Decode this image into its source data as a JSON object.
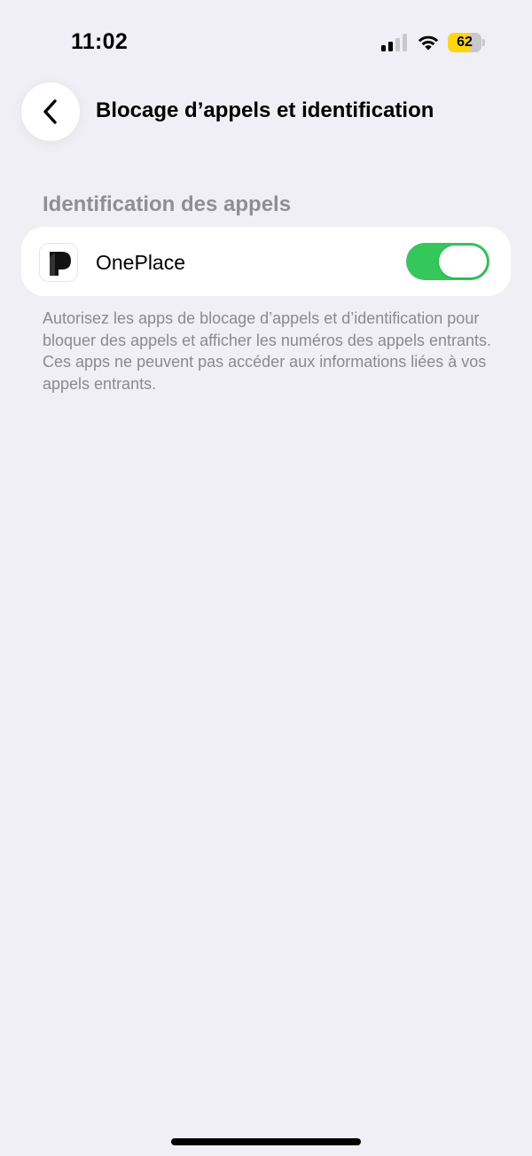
{
  "status_bar": {
    "time": "11:02",
    "battery_level": "62",
    "battery_fraction": 0.62,
    "battery_color": "#ffd60a",
    "signal_bars_active": 2,
    "signal_bars_total": 4
  },
  "nav": {
    "back_icon": "chevron-left-icon",
    "title": "Blocage d’appels et identification"
  },
  "section": {
    "header": "Identification des appels",
    "apps": [
      {
        "name": "OnePlace",
        "icon": "oneplace-app-icon",
        "enabled": true
      }
    ],
    "footer": "Autorisez les apps de blocage d’appels et d’identification pour bloquer des appels et afficher les numéros des appels entrants. Ces apps ne peuvent pas accéder aux informations liées à vos appels entrants."
  },
  "colors": {
    "background": "#f0eff5",
    "toggle_on": "#34c759",
    "secondary_text": "#8e8e93"
  }
}
